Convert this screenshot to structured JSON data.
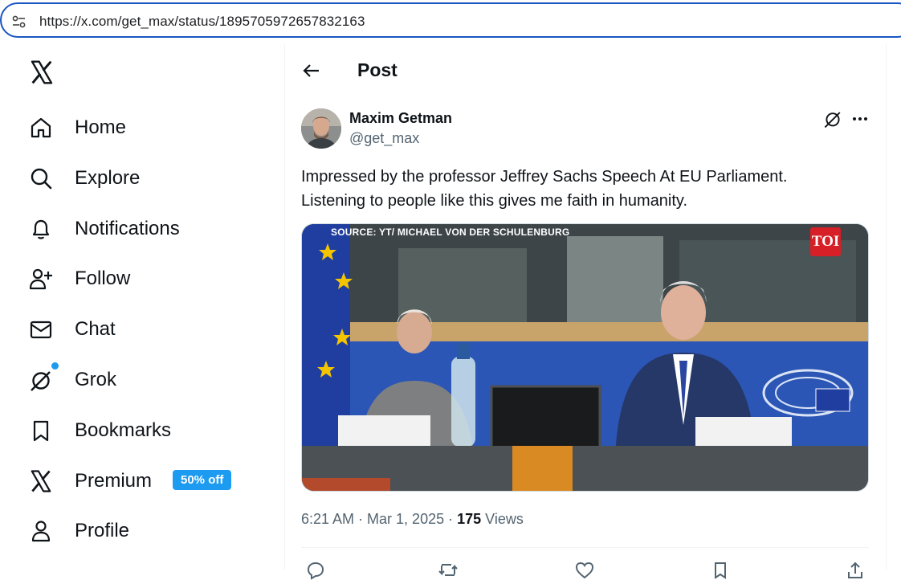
{
  "browser": {
    "url": "https://x.com/get_max/status/1895705972657832163"
  },
  "sidebar": {
    "logo": "x-logo",
    "items": [
      {
        "label": "Home",
        "icon": "home-icon"
      },
      {
        "label": "Explore",
        "icon": "search-icon"
      },
      {
        "label": "Notifications",
        "icon": "bell-icon"
      },
      {
        "label": "Follow",
        "icon": "person-add-icon"
      },
      {
        "label": "Chat",
        "icon": "mail-icon"
      },
      {
        "label": "Grok",
        "icon": "grok-icon"
      },
      {
        "label": "Bookmarks",
        "icon": "bookmark-icon"
      },
      {
        "label": "Premium",
        "icon": "x-icon",
        "badge": "50% off"
      },
      {
        "label": "Profile",
        "icon": "person-icon"
      }
    ]
  },
  "header": {
    "title": "Post"
  },
  "post": {
    "author_name": "Maxim Getman",
    "author_handle": "@get_max",
    "text_line1": "Impressed by the professor Jeffrey Sachs Speech At EU Parliament.",
    "text_line2": "Listening to people like this gives me faith in humanity.",
    "media": {
      "source_caption": "SOURCE: YT/ MICHAEL VON DER SCHULENBURG",
      "badge": "TOI"
    },
    "time": "6:21 AM",
    "date": "Mar 1, 2025",
    "views_count": "175",
    "views_label": "Views"
  },
  "colors": {
    "accent": "#1d9bf0",
    "url_border": "#1a56c2",
    "secondary_text": "#536471"
  }
}
